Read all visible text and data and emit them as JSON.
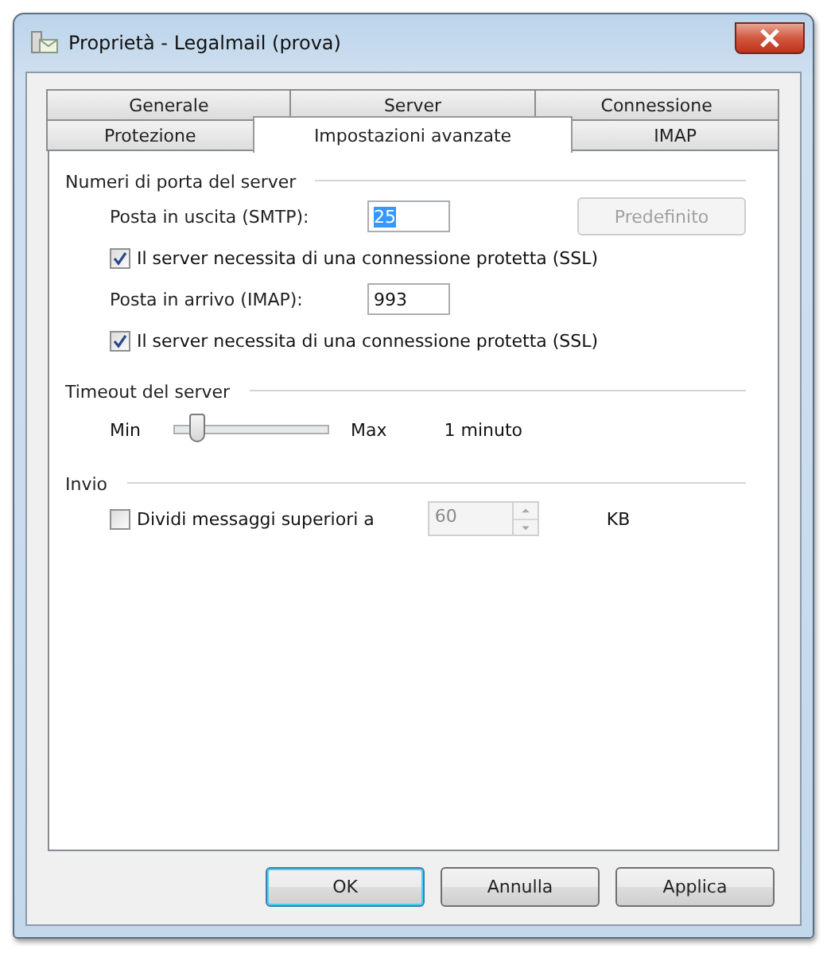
{
  "window": {
    "title": "Proprietà - Legalmail (prova)"
  },
  "tab_rows": [
    {
      "tabs": [
        {
          "label": "Generale",
          "selected": false
        },
        {
          "label": "Server",
          "selected": false
        },
        {
          "label": "Connessione",
          "selected": false
        }
      ]
    },
    {
      "tabs": [
        {
          "label": "Protezione",
          "selected": false
        },
        {
          "label": "Impostazioni avanzate",
          "selected": true
        },
        {
          "label": "IMAP",
          "selected": false
        }
      ]
    }
  ],
  "sections": [
    {
      "title": "Numeri di porta del server",
      "rows": [
        {
          "kind": "port",
          "label": "Posta in uscita (SMTP):",
          "value": "25",
          "text_selected": true,
          "button": {
            "label": "Predefinito",
            "disabled": true
          }
        },
        {
          "kind": "checkbox",
          "label": "Il server necessita di una connessione protetta (SSL)",
          "checked": true
        },
        {
          "kind": "port",
          "label": "Posta in arrivo (IMAP):",
          "value": "993",
          "text_selected": false
        },
        {
          "kind": "checkbox",
          "label": "Il server necessita di una connessione protetta (SSL)",
          "checked": true
        }
      ]
    },
    {
      "title": "Timeout del server",
      "rows": [
        {
          "kind": "slider",
          "min_label": "Min",
          "max_label": "Max",
          "level": 0.15,
          "reading": "1 minuto"
        }
      ]
    },
    {
      "title": "Invio",
      "rows": [
        {
          "kind": "split",
          "label": "Dividi messaggi superiori a",
          "checked": false,
          "value": "60",
          "disabled": true,
          "unit": "KB"
        }
      ]
    }
  ],
  "buttons": [
    {
      "label": "OK",
      "default": true
    },
    {
      "label": "Annulla",
      "default": false
    },
    {
      "label": "Applica",
      "default": false
    }
  ]
}
